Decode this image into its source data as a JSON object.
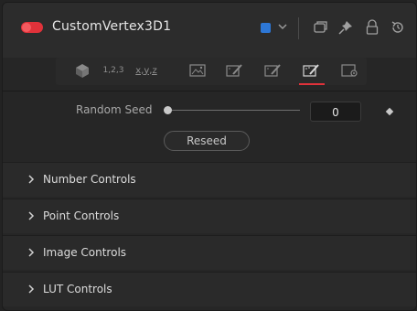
{
  "tool": {
    "name": "CustomVertex3D1",
    "color": "#2d77d6"
  },
  "tabs": [
    {
      "id": "3d-shape-tab",
      "icon": "cube-icon"
    },
    {
      "id": "tab-123",
      "text": "1,2,3"
    },
    {
      "id": "tab-xyz",
      "text": "x,y,z"
    },
    {
      "id": "image-tab",
      "icon": "image-icon"
    },
    {
      "id": "paint-tab-1",
      "icon": "brush-icon"
    },
    {
      "id": "paint-tab-2",
      "icon": "brush-icon"
    },
    {
      "id": "paint-tab-3",
      "icon": "brush-icon",
      "active": true
    },
    {
      "id": "settings-tab",
      "icon": "settings-icon"
    }
  ],
  "controls": {
    "random_seed": {
      "label": "Random Seed",
      "value": "0"
    },
    "reseed_label": "Reseed"
  },
  "sections": [
    {
      "label": "Number Controls"
    },
    {
      "label": "Point Controls"
    },
    {
      "label": "Image Controls"
    },
    {
      "label": "LUT Controls"
    }
  ]
}
